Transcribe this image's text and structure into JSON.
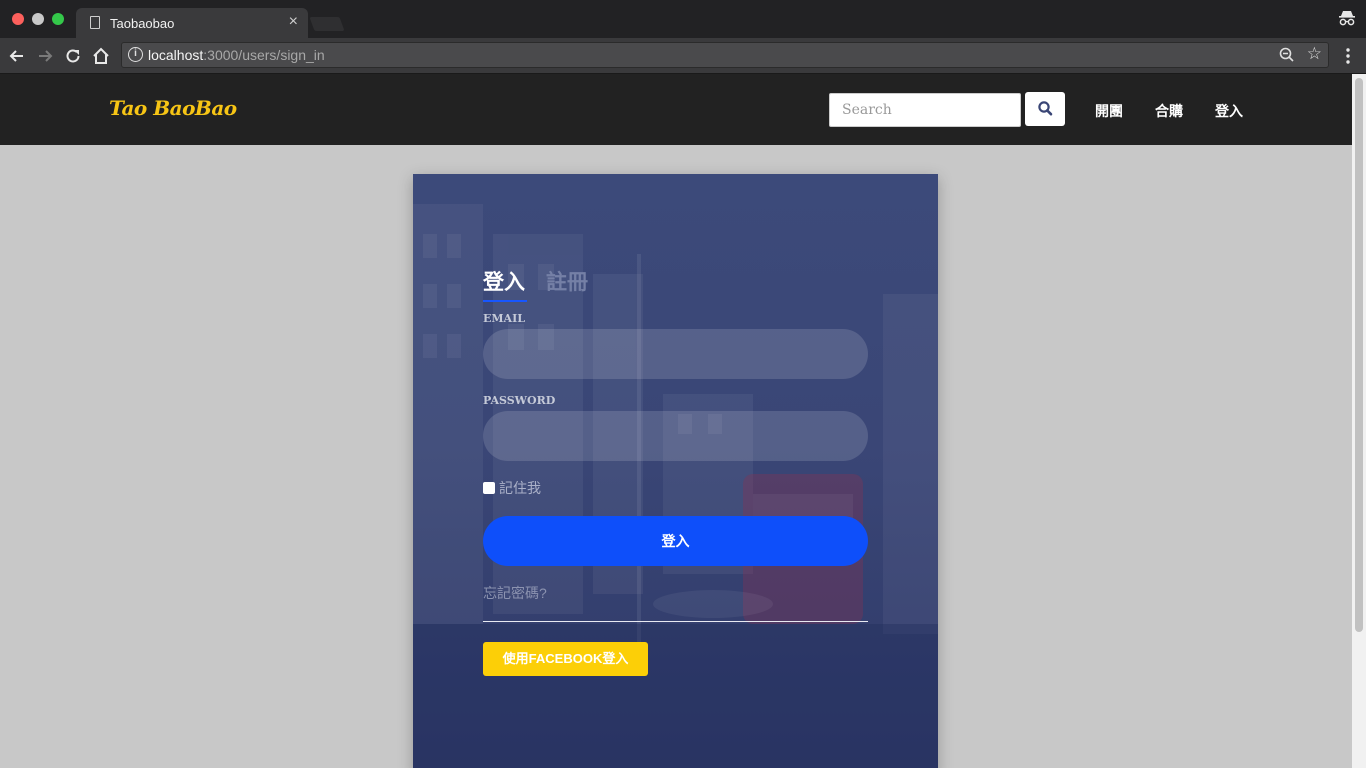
{
  "browser": {
    "tab_title": "Taobaobao",
    "tab_close": "×",
    "url_host": "localhost",
    "url_path": ":3000/users/sign_in"
  },
  "site": {
    "brand": "Tao BaoBao",
    "search_placeholder": "Search",
    "nav": [
      "開團",
      "合購",
      "登入"
    ],
    "accent_color": "#f7c515"
  },
  "login": {
    "tab_login": "登入",
    "tab_register": "註冊",
    "email_label": "EMAIL",
    "password_label": "PASSWORD",
    "remember_label": "記住我",
    "submit_label": "登入",
    "forgot_label": "忘記密碼?",
    "facebook_label": "使用FACEBOOK登入",
    "primary_color": "#0e4ffa",
    "facebook_color": "#fccf07"
  }
}
